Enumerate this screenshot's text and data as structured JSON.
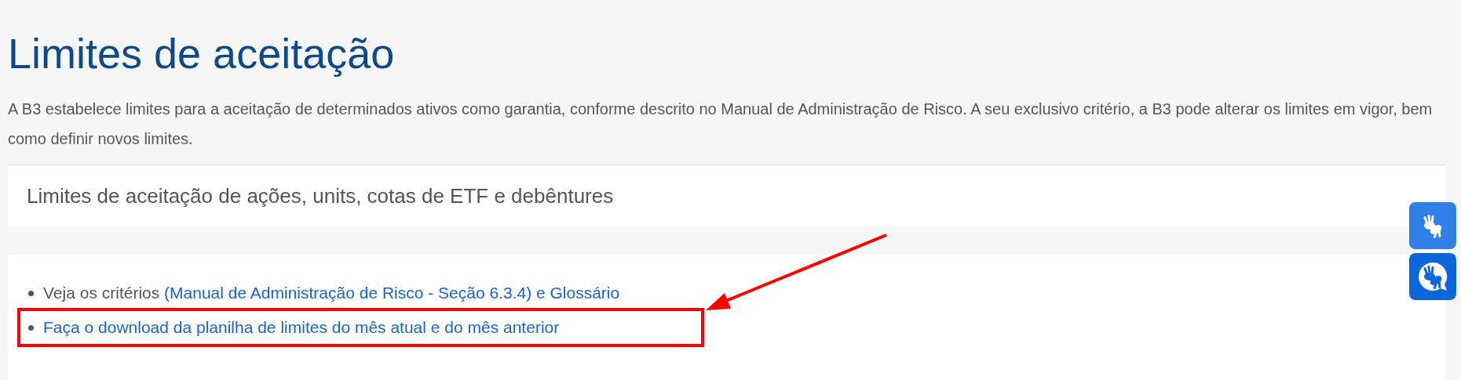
{
  "title": "Limites de aceitação",
  "intro": "A B3 estabelece limites para a aceitação de determinados ativos como garantia, conforme descrito no Manual de Administração de Risco. A seu exclusivo critério, a B3 pode alterar os limites em vigor, bem como definir novos limites.",
  "accordion": {
    "title": "Limites de aceitação de ações, units, cotas de ETF e debêntures",
    "expanded": true
  },
  "items": [
    {
      "text": "Veja os critérios",
      "link": "(Manual de Administração de Risco - Seção 6.3.4) e Glossário",
      "highlighted": false
    },
    {
      "link": "Faça o download da planilha de limites do mês atual e do mês anterior",
      "highlighted": true
    }
  ]
}
